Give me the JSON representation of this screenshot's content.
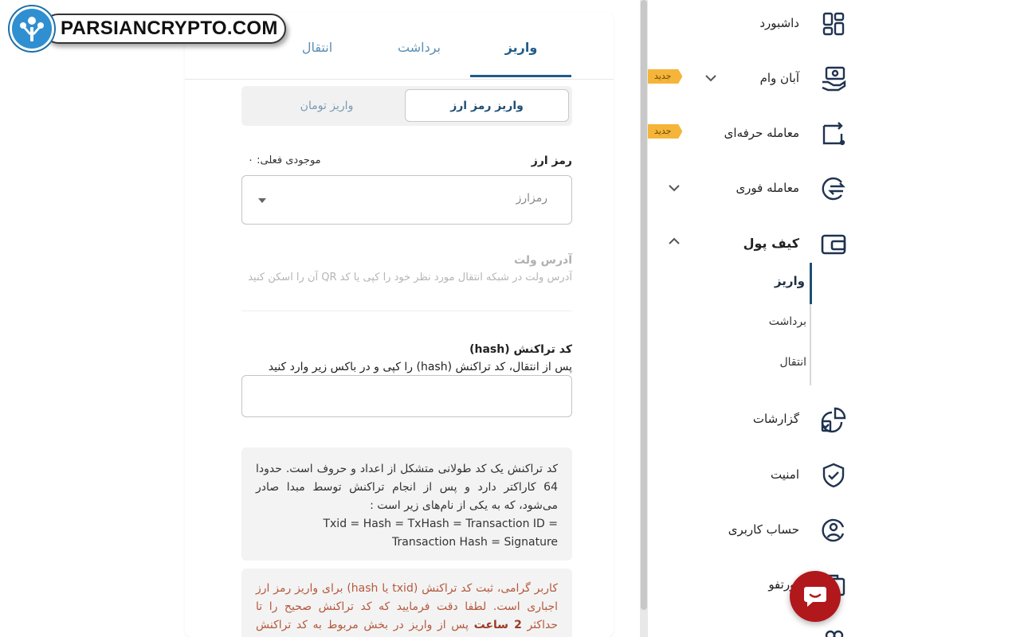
{
  "watermark": {
    "text": "PARSIANCRYPTO.COM"
  },
  "tabs": [
    {
      "label": "واریز",
      "active": true
    },
    {
      "label": "برداشت",
      "active": false
    },
    {
      "label": "انتقال",
      "active": false
    }
  ],
  "segment": {
    "crypto": "واریز رمز ارز",
    "toman": "واریز تومان"
  },
  "currency": {
    "label": "رمز ارز",
    "balance": "موجودی فعلی:  ۰",
    "placeholder": "رمزارز"
  },
  "wallet": {
    "title": "آدرس ولت",
    "description": "آدرس ولت در شبکه انتقال مورد نظر خود را کپی یا کد QR آن را اسکن کنید"
  },
  "hash": {
    "title": "کد تراکنش (hash)",
    "subtitle": "پس از انتقال، کد تراکنش (hash) را کپی و در باکس زیر وارد کنید",
    "value": ""
  },
  "info": {
    "text": "کد تراکنش یک کد طولانی متشکل از اعداد و حروف است. حدودا 64 کاراکتر دارد و پس از انجام تراکنش توسط مبدا صادر می‌شود، که به یکی از نام‌های زیر است :",
    "aliases": "Txid = Hash = TxHash = Transaction ID = Transaction Hash = Signature"
  },
  "warning": {
    "part1": "کاربر گرامی، ثبت کد تراکنش (txid یا hash) برای واریز رمز ارز اجباری است. لطفا دقت فرمایید که کد تراکنش صحیح را تا حداکثر ",
    "bold": "2 ساعت",
    "part2": " پس از واریز در بخش مربوط به کد تراکنش ثبت نمایید. در غیر این"
  },
  "sidebar": {
    "badge_new": "جدید",
    "items": {
      "dashboard": "داشبورد",
      "loan": "آبان وام",
      "pro": "معامله حرفه‌ای",
      "instant": "معامله فوری",
      "wallet": "کیف پول",
      "reports": "گزارشات",
      "security": "امنیت",
      "account": "حساب کاربری",
      "portfolio": "پورتفو"
    },
    "wallet_sub": [
      "واریز",
      "برداشت",
      "انتقال"
    ]
  },
  "colors": {
    "primary": "#1f5d8a",
    "badge": "#f5b43a",
    "warning_text": "#b5593e",
    "chat": "#b0181c"
  }
}
